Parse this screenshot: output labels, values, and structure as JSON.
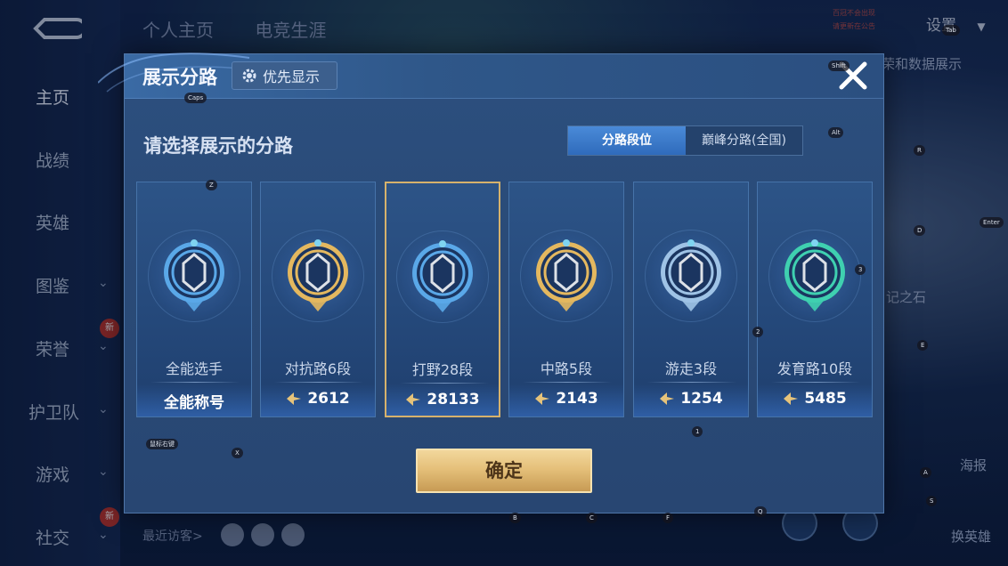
{
  "background": {
    "nav_items": [
      "主页",
      "战绩",
      "英雄",
      "图鉴",
      "荣誉",
      "护卫队",
      "游戏",
      "社交"
    ],
    "new_badge": "新",
    "top_tabs": [
      "个人主页",
      "电竞生涯"
    ],
    "settings_label": "设置",
    "right_texts": [
      "荣和数据展示",
      "记之石",
      "海报",
      "换英雄"
    ],
    "vip_text_1": "百冠不会出现",
    "vip_text_2": "请更新在公告",
    "visitors_label": "最近访客>"
  },
  "dialog": {
    "title": "展示分路",
    "priority_label": "优先显示",
    "subtitle": "请选择展示的分路",
    "toggle": {
      "options": [
        "分路段位",
        "巅峰分路(全国)"
      ],
      "selected": "分路段位"
    },
    "cards": [
      {
        "label": "全能选手",
        "value": "全能称号",
        "emblem": "all-round-emblem",
        "has_icon": false,
        "color": "#5aa8e8"
      },
      {
        "label": "对抗路6段",
        "value": "2612",
        "emblem": "clash-lane-emblem",
        "has_icon": true,
        "color": "#e4b85f"
      },
      {
        "label": "打野28段",
        "value": "28133",
        "emblem": "jungle-emblem",
        "has_icon": true,
        "color": "#5aa8e8",
        "selected": true
      },
      {
        "label": "中路5段",
        "value": "2143",
        "emblem": "mid-lane-emblem",
        "has_icon": true,
        "color": "#e4b85f"
      },
      {
        "label": "游走3段",
        "value": "1254",
        "emblem": "roam-emblem",
        "has_icon": true,
        "color": "#9fc3e6"
      },
      {
        "label": "发育路10段",
        "value": "5485",
        "emblem": "farm-lane-emblem",
        "has_icon": true,
        "color": "#3fd0b0"
      }
    ],
    "confirm_label": "确定"
  },
  "key_hints": [
    "Caps",
    "Shift",
    "Tab",
    "Alt",
    "Z",
    "R",
    "D",
    "Enter",
    "3",
    "2",
    "E",
    "1",
    "X",
    "A",
    "S",
    "B",
    "C",
    "F",
    "Q",
    "鼠标右键"
  ]
}
